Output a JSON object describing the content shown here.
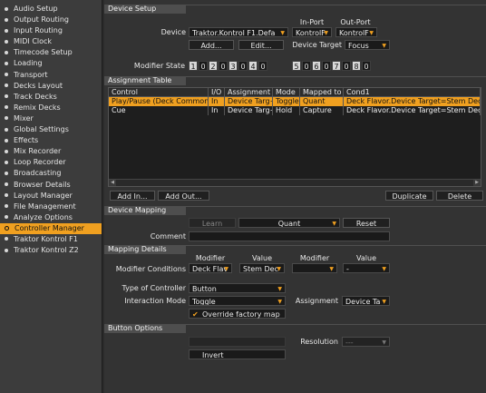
{
  "sidebar": {
    "items": [
      "Audio Setup",
      "Output Routing",
      "Input Routing",
      "MIDI Clock",
      "Timecode Setup",
      "Loading",
      "Transport",
      "Decks Layout",
      "Track Decks",
      "Remix Decks",
      "Mixer",
      "Global Settings",
      "Effects",
      "Mix Recorder",
      "Loop Recorder",
      "Broadcasting",
      "Browser Details",
      "Layout Manager",
      "File Management",
      "Analyze Options",
      "Controller Manager",
      "Traktor Kontrol F1",
      "Traktor Kontrol Z2"
    ],
    "active_index": 20
  },
  "device_setup": {
    "title": "Device Setup",
    "in_port_label": "In-Port",
    "out_port_label": "Out-Port",
    "device_label": "Device",
    "device_value": "Traktor.Kontrol F1.Defa",
    "in_port_value": "KontrolF",
    "out_port_value": "KontrolF",
    "add_label": "Add...",
    "edit_label": "Edit...",
    "device_target_label": "Device Target",
    "device_target_value": "Focus",
    "modifier_state_label": "Modifier State",
    "modifier_states": [
      {
        "n": "1",
        "v": "0"
      },
      {
        "n": "2",
        "v": "0"
      },
      {
        "n": "3",
        "v": "0"
      },
      {
        "n": "4",
        "v": "0"
      },
      {
        "n": "5",
        "v": "0"
      },
      {
        "n": "6",
        "v": "0"
      },
      {
        "n": "7",
        "v": "0"
      },
      {
        "n": "8",
        "v": "0"
      }
    ]
  },
  "assignment_table": {
    "title": "Assignment Table",
    "columns": [
      "Control",
      "I/O",
      "Assignment",
      "Mode",
      "Mapped to",
      "Cond1"
    ],
    "rows": [
      [
        "Play/Pause (Deck Common)",
        "In",
        "Device Targ~",
        "Toggle",
        "Quant",
        "Deck Flavor.Device Target=Stem Deck"
      ],
      [
        "Cue",
        "In",
        "Device Targ~",
        "Hold",
        "Capture",
        "Deck Flavor.Device Target=Stem Deck"
      ]
    ],
    "add_in_label": "Add In...",
    "add_out_label": "Add Out...",
    "duplicate_label": "Duplicate",
    "delete_label": "Delete"
  },
  "device_mapping": {
    "title": "Device Mapping",
    "learn_label": "Learn",
    "mapped_value": "Quant",
    "reset_label": "Reset",
    "comment_label": "Comment",
    "comment_value": ""
  },
  "mapping_details": {
    "title": "Mapping Details",
    "modifier_header_1": "Modifier",
    "value_header_1": "Value",
    "modifier_header_2": "Modifier",
    "value_header_2": "Value",
    "modifier_conditions_label": "Modifier Conditions",
    "cond1_modifier": "Deck Flav",
    "cond1_value": "Stem Dec",
    "cond2_modifier": "",
    "cond2_value": "-",
    "type_label": "Type of Controller",
    "type_value": "Button",
    "interaction_label": "Interaction Mode",
    "interaction_value": "Toggle",
    "assignment_label": "Assignment",
    "assignment_value": "Device Ta",
    "override_label": "Override factory map",
    "override_checked": true
  },
  "button_options": {
    "title": "Button Options",
    "resolution_label": "Resolution",
    "resolution_value": "---",
    "invert_label": "Invert",
    "invert_checked": false
  }
}
